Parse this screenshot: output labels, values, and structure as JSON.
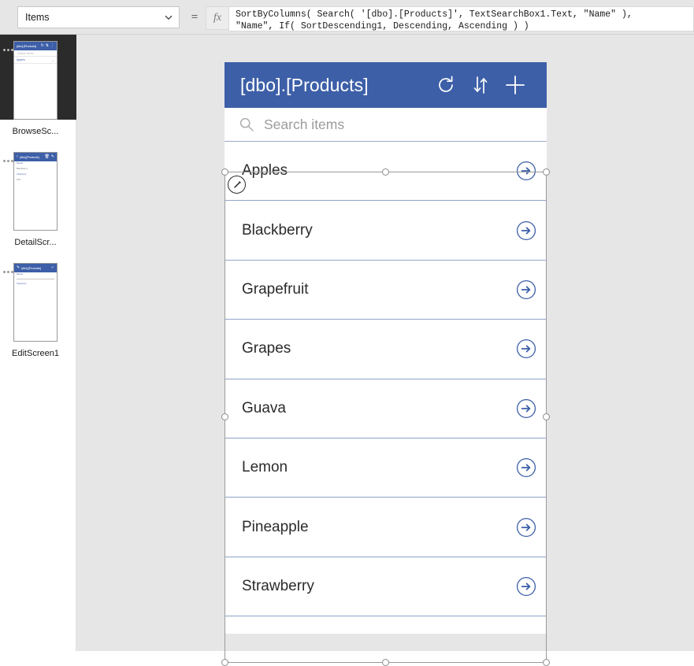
{
  "formula_bar": {
    "property_value": "Items",
    "property_options": [
      "Items"
    ],
    "chevron_icon": "chevron-down-icon",
    "equals": "=",
    "fx_label": "fx",
    "formula_text": "SortByColumns( Search( '[dbo].[Products]', TextSearchBox1.Text, \"Name\" ),\n\"Name\", If( SortDescending1, Descending, Ascending ) )"
  },
  "screens": [
    {
      "label": "BrowseSc...",
      "selected": true,
      "thumb": {
        "header_title": "[dbo].[Products]",
        "icons": [
          "refresh-icon",
          "sort-icon",
          "add-icon"
        ],
        "search_text": "Search items",
        "rows": [
          "Apples"
        ]
      }
    },
    {
      "label": "DetailScr...",
      "selected": false,
      "thumb": {
        "header_title": "[dbo].[Products]",
        "icons": [
          "back-icon",
          "trash-icon",
          "edit-icon"
        ],
        "lines": [
          "Name",
          "Blackberry",
          "Inventory",
          "100"
        ]
      }
    },
    {
      "label": "EditScreen1",
      "selected": false,
      "thumb": {
        "header_title": "[dbo].[Products]",
        "icons": [
          "edit-icon",
          "check-icon"
        ],
        "lines": [
          "Name",
          "Inventory"
        ]
      }
    }
  ],
  "app": {
    "header": {
      "title": "[dbo].[Products]",
      "refresh_icon": "refresh-icon",
      "sort_icon": "sort-icon",
      "add_icon": "add-icon",
      "background": "#3d5fa8"
    },
    "search": {
      "icon": "search-icon",
      "placeholder": "Search items",
      "value": ""
    },
    "gallery": {
      "separator_color": "#8fa4c9",
      "next_icon": "arrow-right-circle-icon",
      "accent": "#3d5fa8",
      "items": [
        {
          "name": "Apples"
        },
        {
          "name": "Blackberry"
        },
        {
          "name": "Grapefruit"
        },
        {
          "name": "Grapes"
        },
        {
          "name": "Guava"
        },
        {
          "name": "Lemon"
        },
        {
          "name": "Pineapple"
        },
        {
          "name": "Strawberry"
        }
      ]
    },
    "selection": {
      "edit_badge_icon": "pencil-icon",
      "handle_count": 8
    }
  }
}
